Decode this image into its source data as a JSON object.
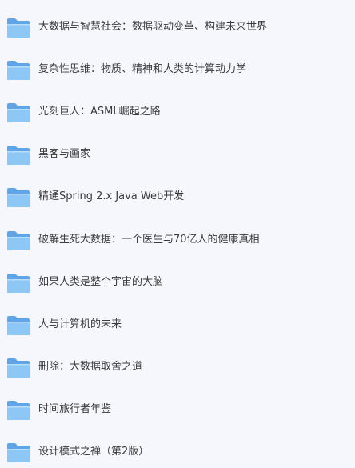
{
  "colors": {
    "background": "#f6f7fd",
    "folder_front": "#8cc7f5",
    "folder_back": "#5fa5e8",
    "text": "#3b3b3b"
  },
  "items": [
    {
      "label": "大数据与智慧社会：数据驱动变革、构建未来世界",
      "icon": "folder-icon"
    },
    {
      "label": "复杂性思维：物质、精神和人类的计算动力学",
      "icon": "folder-icon"
    },
    {
      "label": "光刻巨人：ASML崛起之路",
      "icon": "folder-icon"
    },
    {
      "label": "黑客与画家",
      "icon": "folder-icon"
    },
    {
      "label": "精通Spring 2.x Java Web开发",
      "icon": "folder-icon"
    },
    {
      "label": "破解生死大数据：一个医生与70亿人的健康真相",
      "icon": "folder-icon"
    },
    {
      "label": "如果人类是整个宇宙的大脑",
      "icon": "folder-icon"
    },
    {
      "label": "人与计算机的未来",
      "icon": "folder-icon"
    },
    {
      "label": "删除：大数据取舍之道",
      "icon": "folder-icon"
    },
    {
      "label": "时间旅行者年鉴",
      "icon": "folder-icon"
    },
    {
      "label": "设计模式之禅（第2版）",
      "icon": "folder-icon"
    }
  ]
}
